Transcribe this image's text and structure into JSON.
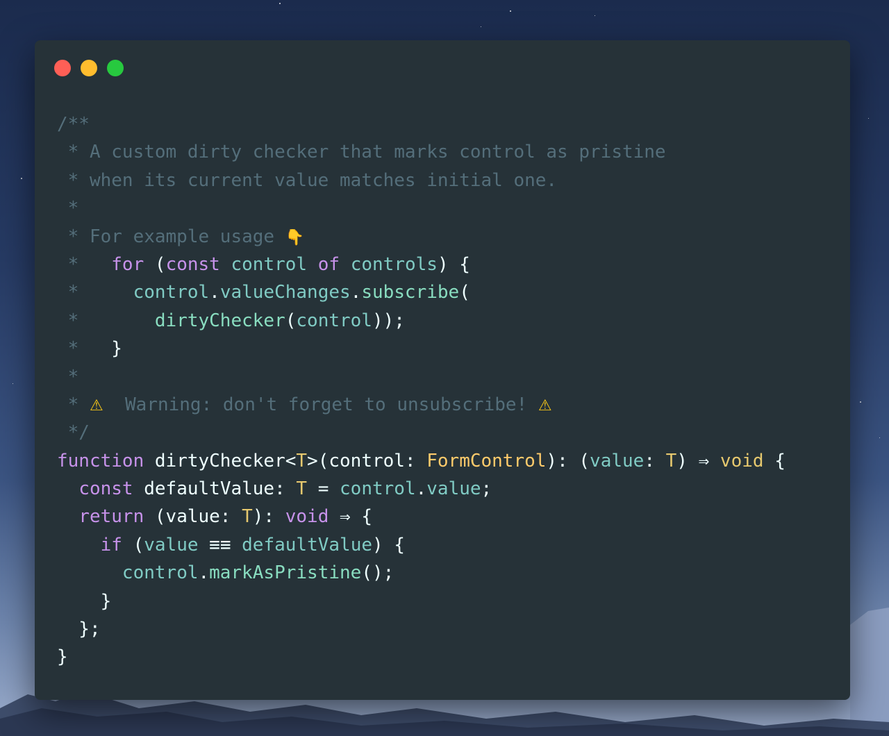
{
  "window": {
    "lights": [
      {
        "name": "close",
        "color": "#ff5f56"
      },
      {
        "name": "minimize",
        "color": "#ffbd2e"
      },
      {
        "name": "maximize",
        "color": "#27c93f"
      }
    ]
  },
  "colors": {
    "background": "#263238",
    "comment": "#546e7a",
    "keyword": "#c792ea",
    "text": "#eeffff",
    "variable": "#80cbc4",
    "type": "#ffcb6b"
  },
  "code": {
    "lines": [
      [
        {
          "t": "/**",
          "c": "comment"
        }
      ],
      [
        {
          "t": " * A custom dirty checker that marks control as pristine",
          "c": "comment"
        }
      ],
      [
        {
          "t": " * when its current value matches initial one.",
          "c": "comment"
        }
      ],
      [
        {
          "t": " *",
          "c": "comment"
        }
      ],
      [
        {
          "t": " * For example usage ",
          "c": "comment"
        },
        {
          "t": "👇",
          "c": "emoji emoji-point",
          "icon": "pointing-down-icon"
        }
      ],
      [
        {
          "t": " *   ",
          "c": "comment"
        },
        {
          "t": "for",
          "c": "keyword"
        },
        {
          "t": " (",
          "c": "text"
        },
        {
          "t": "const",
          "c": "keyword"
        },
        {
          "t": " ",
          "c": "text"
        },
        {
          "t": "control",
          "c": "var"
        },
        {
          "t": " ",
          "c": "text"
        },
        {
          "t": "of",
          "c": "keyword"
        },
        {
          "t": " ",
          "c": "text"
        },
        {
          "t": "controls",
          "c": "var"
        },
        {
          "t": ") {",
          "c": "text"
        }
      ],
      [
        {
          "t": " *     ",
          "c": "comment"
        },
        {
          "t": "control",
          "c": "var"
        },
        {
          "t": ".",
          "c": "text"
        },
        {
          "t": "valueChanges",
          "c": "var"
        },
        {
          "t": ".",
          "c": "text"
        },
        {
          "t": "subscribe",
          "c": "func"
        },
        {
          "t": "(",
          "c": "text"
        }
      ],
      [
        {
          "t": " *       ",
          "c": "comment"
        },
        {
          "t": "dirtyChecker",
          "c": "func"
        },
        {
          "t": "(",
          "c": "text"
        },
        {
          "t": "control",
          "c": "var"
        },
        {
          "t": "));",
          "c": "text"
        }
      ],
      [
        {
          "t": " *   ",
          "c": "comment"
        },
        {
          "t": "}",
          "c": "text"
        }
      ],
      [
        {
          "t": " *",
          "c": "comment"
        }
      ],
      [
        {
          "t": " * ",
          "c": "comment"
        },
        {
          "t": "⚠",
          "c": "emoji emoji-warn",
          "icon": "warning-icon"
        },
        {
          "t": "  Warning: don't forget to unsubscribe! ",
          "c": "comment"
        },
        {
          "t": "⚠",
          "c": "emoji emoji-warn",
          "icon": "warning-icon"
        }
      ],
      [
        {
          "t": " */",
          "c": "comment"
        }
      ],
      [
        {
          "t": "function",
          "c": "keyword"
        },
        {
          "t": " dirtyChecker<",
          "c": "text"
        },
        {
          "t": "T",
          "c": "typeparam"
        },
        {
          "t": ">(control: ",
          "c": "text"
        },
        {
          "t": "FormControl",
          "c": "type"
        },
        {
          "t": "): (",
          "c": "text"
        },
        {
          "t": "value",
          "c": "param"
        },
        {
          "t": ": ",
          "c": "text"
        },
        {
          "t": "T",
          "c": "typeparam"
        },
        {
          "t": ") ⇒ ",
          "c": "text"
        },
        {
          "t": "void",
          "c": "typeparam"
        },
        {
          "t": " {",
          "c": "text"
        }
      ],
      [
        {
          "t": "  ",
          "c": "text"
        },
        {
          "t": "const",
          "c": "keyword"
        },
        {
          "t": " defaultValue: ",
          "c": "text"
        },
        {
          "t": "T",
          "c": "typeparam"
        },
        {
          "t": " = ",
          "c": "text"
        },
        {
          "t": "control",
          "c": "var"
        },
        {
          "t": ".",
          "c": "text"
        },
        {
          "t": "value",
          "c": "var"
        },
        {
          "t": ";",
          "c": "text"
        }
      ],
      [
        {
          "t": "  ",
          "c": "text"
        },
        {
          "t": "return",
          "c": "keyword"
        },
        {
          "t": " (value: ",
          "c": "text"
        },
        {
          "t": "T",
          "c": "typeparam"
        },
        {
          "t": "): ",
          "c": "text"
        },
        {
          "t": "void",
          "c": "keyword"
        },
        {
          "t": " ⇒ {",
          "c": "text"
        }
      ],
      [
        {
          "t": "    ",
          "c": "text"
        },
        {
          "t": "if",
          "c": "keyword"
        },
        {
          "t": " (",
          "c": "text"
        },
        {
          "t": "value",
          "c": "var"
        },
        {
          "t": " ≡≡ ",
          "c": "text"
        },
        {
          "t": "defaultValue",
          "c": "var"
        },
        {
          "t": ") {",
          "c": "text"
        }
      ],
      [
        {
          "t": "      ",
          "c": "text"
        },
        {
          "t": "control",
          "c": "var"
        },
        {
          "t": ".",
          "c": "text"
        },
        {
          "t": "markAsPristine",
          "c": "func"
        },
        {
          "t": "();",
          "c": "text"
        }
      ],
      [
        {
          "t": "    }",
          "c": "text"
        }
      ],
      [
        {
          "t": "  };",
          "c": "text"
        }
      ],
      [
        {
          "t": "}",
          "c": "text"
        }
      ]
    ]
  }
}
